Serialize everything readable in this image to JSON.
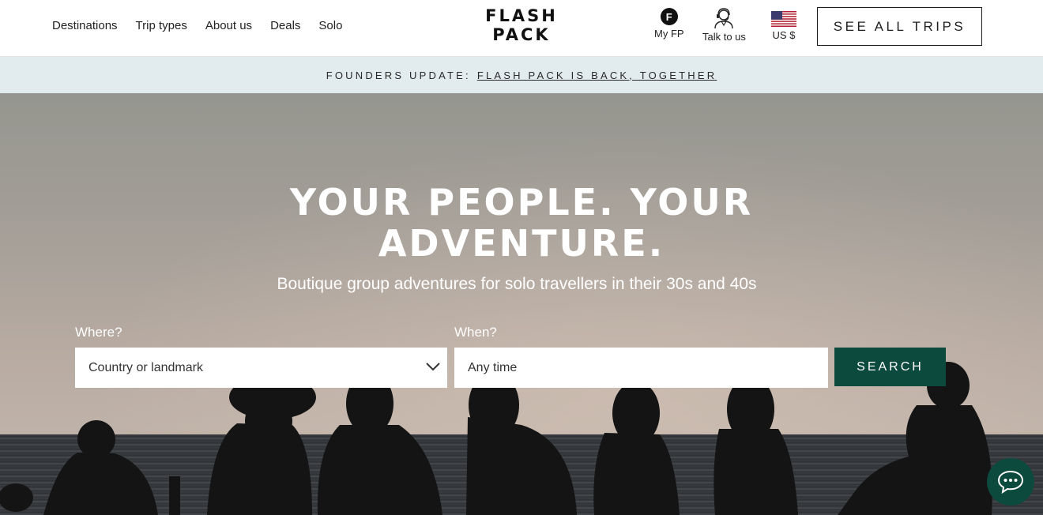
{
  "header": {
    "nav": [
      "Destinations",
      "Trip types",
      "About us",
      "Deals",
      "Solo"
    ],
    "logo_line1": "FLASH",
    "logo_line2": "PACK",
    "my_fp_glyph": "F",
    "my_fp_label": "My FP",
    "talk_label": "Talk to us",
    "currency_label": "US $",
    "see_all": "SEE ALL TRIPS"
  },
  "banner": {
    "prefix": "FOUNDERS UPDATE:",
    "link": "FLASH PACK IS BACK, TOGETHER"
  },
  "hero": {
    "headline_line1": "YOUR PEOPLE. YOUR",
    "headline_line2": "ADVENTURE.",
    "subline": "Boutique group adventures for solo travellers in their 30s and 40s"
  },
  "search": {
    "where_label": "Where?",
    "where_value": "Country or landmark",
    "when_label": "When?",
    "when_value": "Any time",
    "button": "SEARCH"
  },
  "icons": {
    "my_fp": "fp-circle-icon",
    "talk": "agent-icon",
    "currency": "us-flag-icon",
    "dropdown": "chevron-down-icon",
    "chat": "chat-bubble-icon"
  },
  "colors": {
    "accent": "#0d4a3e",
    "banner_bg": "#e2ecee"
  }
}
